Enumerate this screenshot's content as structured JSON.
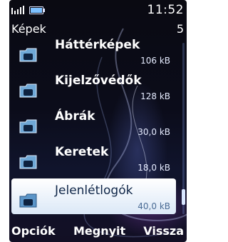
{
  "status": {
    "time": "11:52",
    "signal_icon": "signal-icon",
    "battery_icon": "battery-icon"
  },
  "header": {
    "title": "Képek",
    "count": "5"
  },
  "folders": [
    {
      "name": "Háttérképek",
      "size": "106 kB",
      "icon": "folder-icon"
    },
    {
      "name": "Kijelzővédők",
      "size": "128 kB",
      "icon": "folder-icon"
    },
    {
      "name": "Ábrák",
      "size": "30,0 kB",
      "icon": "folder-icon"
    },
    {
      "name": "Keretek",
      "size": "18,0 kB",
      "icon": "folder-icon"
    },
    {
      "name": "Jelenlétlogók",
      "size": "40,0 kB",
      "icon": "folder-icon",
      "selected": true
    }
  ],
  "softkeys": {
    "left": "Opciók",
    "middle": "Megnyit",
    "right": "Vissza"
  },
  "colors": {
    "background": "#0b0c1a",
    "selection": "#dbe8f7",
    "text": "#ffffff"
  }
}
